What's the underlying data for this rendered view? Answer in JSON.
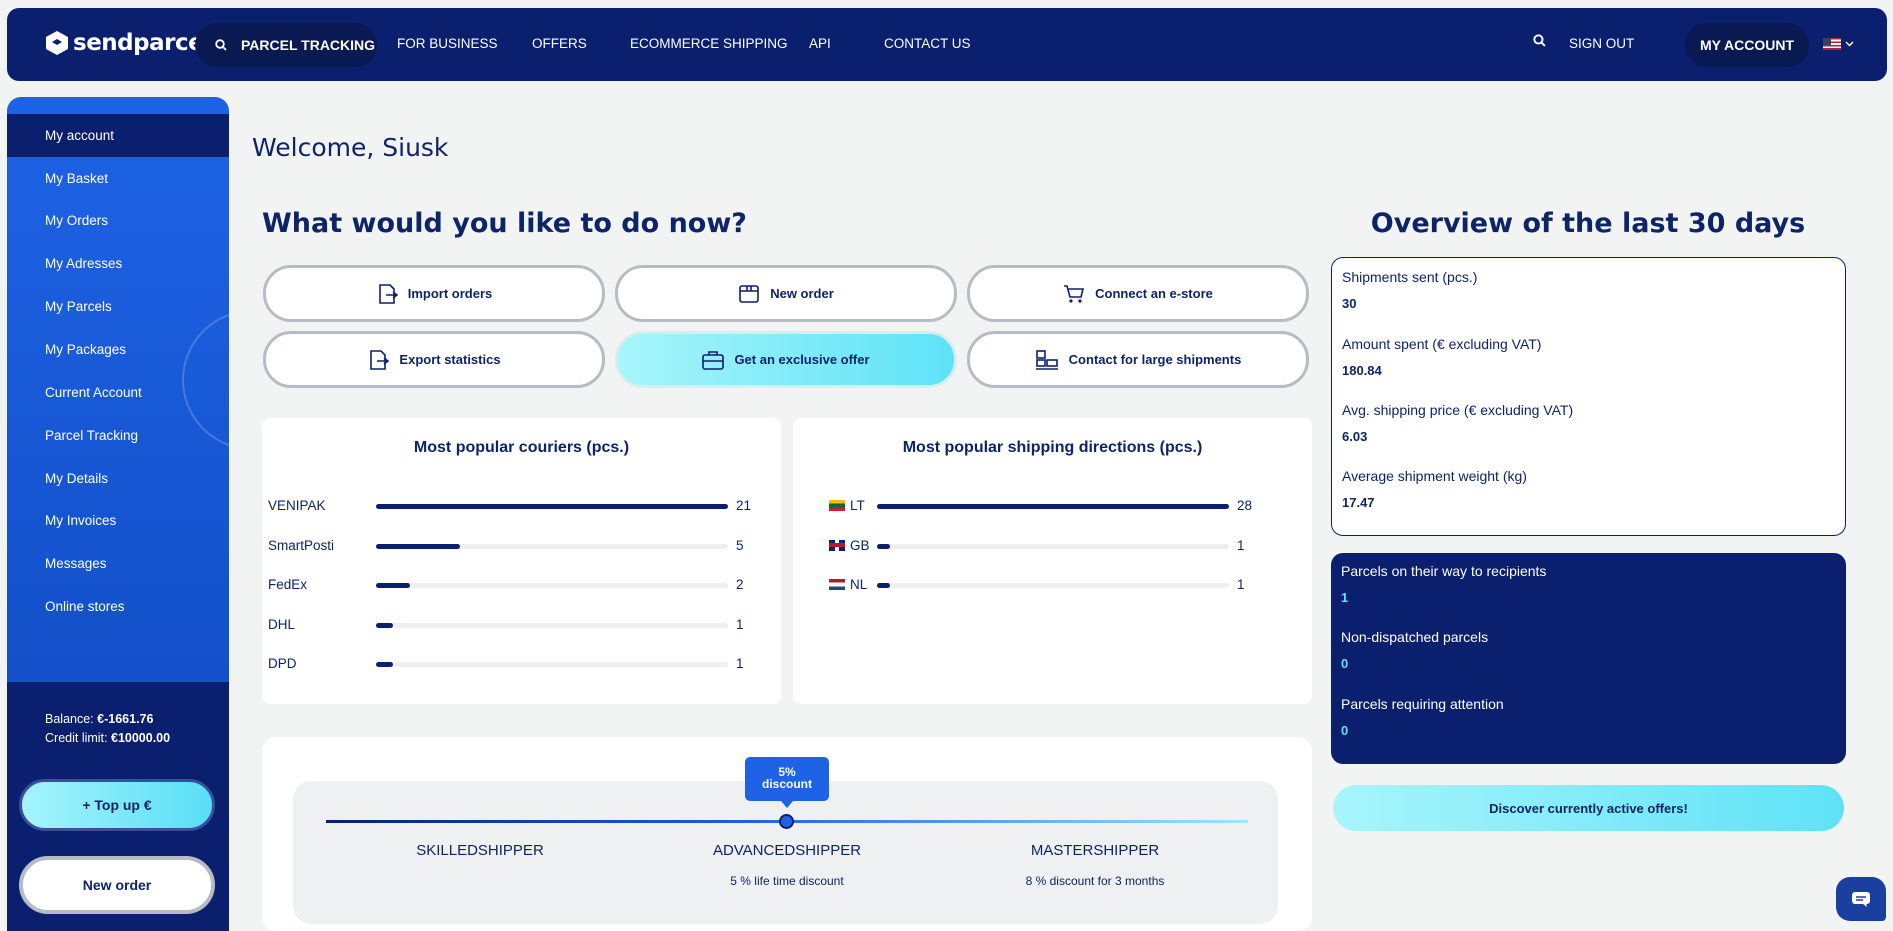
{
  "nav": {
    "brand": "sendparcel",
    "tracking": "PARCEL TRACKING",
    "links": [
      "FOR BUSINESS",
      "OFFERS",
      "ECOMMERCE SHIPPING",
      "API",
      "CONTACT US"
    ],
    "signout": "SIGN OUT",
    "account": "MY ACCOUNT"
  },
  "sidebar": {
    "items": [
      "My account",
      "My Basket",
      "My Orders",
      "My Adresses",
      "My Parcels",
      "My Packages",
      "Current Account",
      "Parcel Tracking",
      "My Details",
      "My Invoices",
      "Messages",
      "Online stores"
    ],
    "balance_label": "Balance:",
    "balance_value": "€-1661.76",
    "credit_label": "Credit limit:",
    "credit_value": "€10000.00",
    "topup": "+ Top up €",
    "new_order": "New order"
  },
  "main": {
    "welcome": "Welcome, Siusk",
    "question": "What would you like to do now?",
    "actions": [
      "Import orders",
      "New order",
      "Connect an e-store",
      "Export statistics",
      "Get an exclusive offer",
      "Contact for large shipments"
    ]
  },
  "chart_data": [
    {
      "type": "bar",
      "title": "Most popular couriers (pcs.)",
      "categories": [
        "VENIPAK",
        "SmartPosti",
        "FedEx",
        "DHL",
        "DPD"
      ],
      "values": [
        21,
        5,
        2,
        1,
        1
      ]
    },
    {
      "type": "bar",
      "title": "Most popular shipping directions (pcs.)",
      "categories": [
        "LT",
        "GB",
        "NL"
      ],
      "values": [
        28,
        1,
        1
      ]
    }
  ],
  "loyalty": {
    "tooltip_line1": "5%",
    "tooltip_line2": "discount",
    "levels": [
      {
        "name": "SKILLEDSHIPPER",
        "desc": ""
      },
      {
        "name": "ADVANCEDSHIPPER",
        "desc": "5 % life time discount"
      },
      {
        "name": "MASTERSHIPPER",
        "desc": "8 % discount for 3 months"
      }
    ]
  },
  "overview": {
    "title": "Overview of the last 30 days",
    "stats": [
      {
        "label": "Shipments sent (pcs.)",
        "value": "30"
      },
      {
        "label": "Amount spent (€ excluding VAT)",
        "value": "180.84"
      },
      {
        "label": "Avg. shipping price (€ excluding VAT)",
        "value": "6.03"
      },
      {
        "label": "Average shipment weight (kg)",
        "value": "17.47"
      }
    ],
    "parcels": [
      {
        "label": "Parcels on their way to recipients",
        "value": "1"
      },
      {
        "label": "Non-dispatched parcels",
        "value": "0"
      },
      {
        "label": "Parcels requiring attention",
        "value": "0"
      }
    ],
    "offers_button": "Discover currently active offers!"
  },
  "colors": {
    "navy": "#0b1f6f",
    "blue": "#1e63e6",
    "cyan": "#5ee2f7"
  }
}
